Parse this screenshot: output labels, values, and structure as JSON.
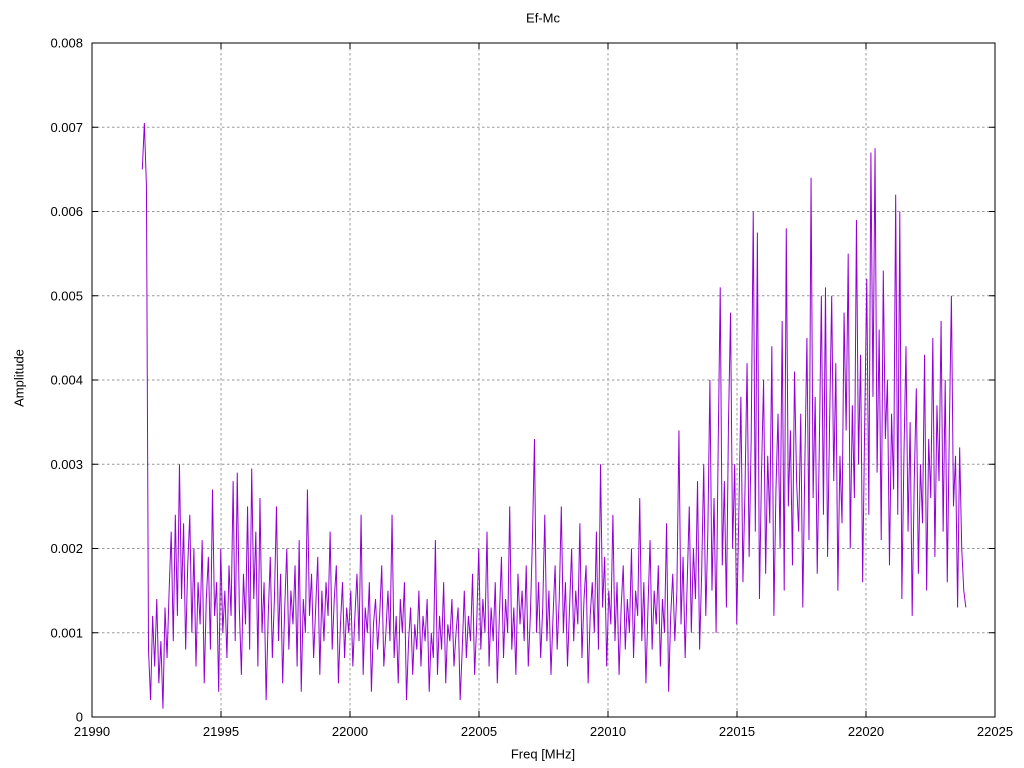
{
  "page": {
    "background": "#ffffff",
    "border_color": "#000000"
  },
  "chart_data": {
    "type": "line",
    "title": "Ef-Mc",
    "xlabel": "Freq [MHz]",
    "ylabel": "Amplitude",
    "xlim": [
      21990,
      22025
    ],
    "ylim": [
      0,
      0.008
    ],
    "xticks": [
      21990,
      21995,
      22000,
      22005,
      22010,
      22015,
      22020,
      22025
    ],
    "xtick_labels": [
      "21990",
      "21995",
      "22000",
      "22005",
      "22010",
      "22015",
      "22020",
      "22025"
    ],
    "yticks": [
      0,
      0.001,
      0.002,
      0.003,
      0.004,
      0.005,
      0.006,
      0.007,
      0.008
    ],
    "ytick_labels": [
      "0",
      "0.001",
      "0.002",
      "0.003",
      "0.004",
      "0.005",
      "0.006",
      "0.007",
      "0.008"
    ],
    "grid": true,
    "grid_style": "dashed",
    "grid_color": "#999999",
    "legend_position": "none",
    "line_color": "#9400d3",
    "series": [
      {
        "name": "Ef-Mc",
        "x_start": 21991.95,
        "x_step": 0.08,
        "y_unit": 0.0001,
        "y": [
          65,
          70.5,
          63,
          8,
          2,
          12,
          6,
          14,
          4,
          9,
          1,
          13,
          7,
          15,
          22,
          9,
          24,
          12,
          30,
          14,
          23,
          8,
          18,
          24,
          10,
          20,
          6,
          16,
          11,
          21,
          4,
          14,
          19,
          8,
          27,
          12,
          16,
          3,
          20,
          10,
          15,
          7,
          18,
          12,
          28,
          9,
          29,
          13,
          5,
          17,
          11,
          25,
          8,
          29.5,
          14,
          22,
          6,
          26,
          10,
          16,
          2,
          12,
          19,
          7,
          14,
          25,
          9,
          17,
          4,
          13,
          20,
          8,
          15,
          11,
          18,
          6,
          21,
          3,
          14,
          10,
          27,
          12,
          17,
          7,
          13,
          19,
          5,
          15,
          9,
          16,
          12,
          22,
          8,
          14,
          18,
          4,
          11,
          16,
          7,
          13,
          10,
          15,
          6,
          12,
          17,
          9,
          24,
          5,
          13,
          10,
          16,
          3,
          11,
          14,
          8,
          12,
          18,
          6,
          10,
          15,
          9,
          24,
          7,
          12,
          4,
          14,
          10,
          16,
          2,
          9,
          13,
          5,
          11,
          8,
          15,
          6,
          12,
          9,
          14,
          3,
          10,
          7,
          21,
          5,
          12,
          8,
          16,
          4,
          11,
          9,
          14,
          6,
          10,
          13,
          2,
          8,
          15,
          7,
          12,
          9,
          17,
          5,
          11,
          20,
          8,
          14,
          10,
          22,
          6,
          13,
          9,
          16,
          4,
          12,
          19,
          7,
          14,
          10,
          25,
          8,
          13,
          5,
          17,
          11,
          15,
          9,
          18,
          6,
          12,
          21,
          33,
          10,
          16,
          7,
          13,
          24,
          9,
          15,
          5,
          12,
          18,
          8,
          14,
          25,
          10,
          16,
          6,
          13,
          20,
          9,
          15,
          11,
          23,
          7,
          14,
          18,
          4,
          12,
          16,
          10,
          22,
          8,
          30,
          13,
          19,
          6,
          15,
          11,
          24,
          9,
          16,
          5,
          13,
          18,
          8,
          14,
          10,
          20,
          7,
          15,
          12,
          26,
          9,
          16,
          4,
          13,
          21,
          8,
          15,
          11,
          18,
          6,
          14,
          10,
          23,
          3,
          12,
          17,
          9,
          15,
          34,
          11,
          19,
          7,
          16,
          25,
          10,
          20,
          14,
          28,
          8,
          17,
          30,
          12,
          22,
          40,
          15,
          26,
          10,
          32,
          51,
          18,
          28,
          13,
          35,
          48,
          20,
          30,
          11,
          24,
          38,
          16,
          27,
          42,
          19,
          33,
          60,
          22,
          57.5,
          14,
          29,
          40,
          17,
          31,
          23,
          44,
          12,
          27,
          36,
          20,
          47,
          15,
          58,
          25,
          34,
          18,
          41,
          28,
          22,
          36,
          13,
          30,
          45,
          21,
          64,
          26,
          38,
          17,
          32,
          50,
          24,
          51,
          19,
          35,
          50,
          28,
          42,
          15,
          31,
          23,
          48,
          34,
          55,
          20,
          37,
          26,
          59,
          30,
          43,
          16,
          35,
          52,
          24,
          67,
          38,
          67.5,
          29,
          46,
          21,
          53,
          33,
          40,
          18,
          36,
          27,
          62,
          24,
          60,
          14,
          31,
          44,
          22,
          35,
          12,
          28,
          39,
          17,
          30,
          23,
          43,
          15,
          33,
          26,
          45,
          19,
          37,
          28,
          47,
          22,
          40,
          16,
          34,
          50,
          25,
          31,
          13,
          32,
          20,
          15,
          13
        ]
      }
    ]
  }
}
